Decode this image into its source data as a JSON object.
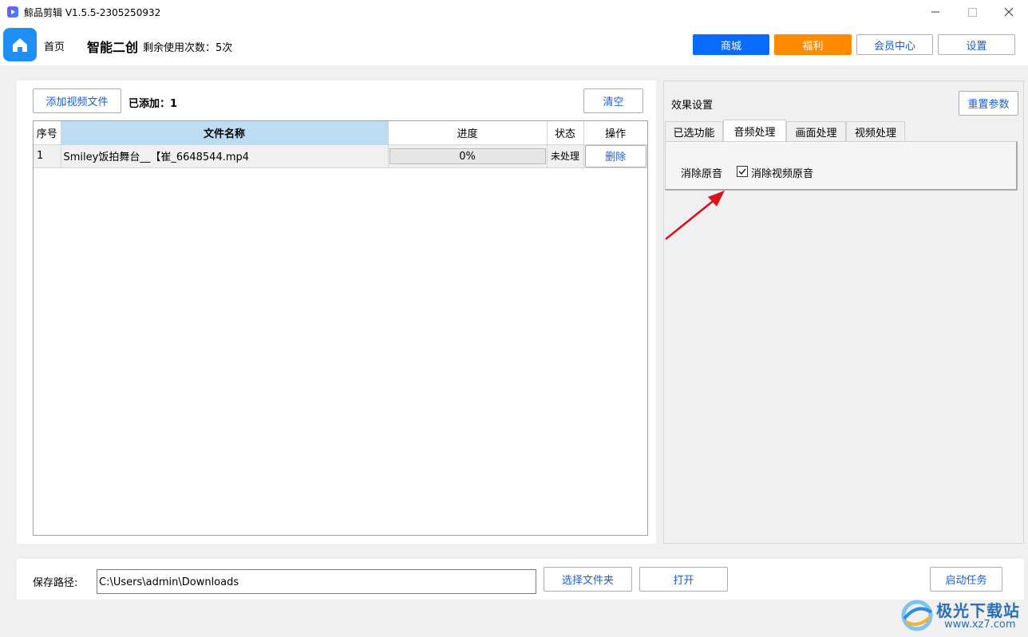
{
  "window": {
    "title": "鲸品剪辑 V1.5.5-2305250932",
    "minimize_icon": "minimize-icon",
    "maximize_icon": "maximize-icon",
    "close_icon": "close-icon"
  },
  "header": {
    "home_label": "首页",
    "mode_title": "智能二创",
    "usage_text": "剩余使用次数：5次",
    "buttons": {
      "shop": "商城",
      "benefits": "福利",
      "member": "会员中心",
      "settings": "设置"
    },
    "colors": {
      "shop": "#0a6cff",
      "benefits": "#ff8a00"
    }
  },
  "files": {
    "add_button": "添加视频文件",
    "added_label": "已添加：1",
    "clear_button": "清空",
    "columns": [
      "序号",
      "文件名称",
      "进度",
      "状态",
      "操作"
    ],
    "rows": [
      {
        "index": "1",
        "name": "Smiley饭拍舞台__【崔_6648544.mp4",
        "progress": "0%",
        "progress_value": 0,
        "status": "未处理",
        "action": "删除"
      }
    ]
  },
  "effects": {
    "title": "效果设置",
    "reset_button": "重置参数",
    "tabs": [
      "已选功能",
      "音频处理",
      "画面处理",
      "视频处理"
    ],
    "active_tab": "音频处理",
    "option_label": "消除原音",
    "checkbox_label": "消除视频原音",
    "checkbox_checked": true
  },
  "footer": {
    "save_path_label": "保存路径:",
    "save_path_value": "C:\\Users\\admin\\Downloads",
    "choose_folder_button": "选择文件夹",
    "open_button": "打开",
    "start_button": "启动任务"
  },
  "watermark": {
    "text": "极光下载站",
    "url": "www.xz7.com"
  }
}
